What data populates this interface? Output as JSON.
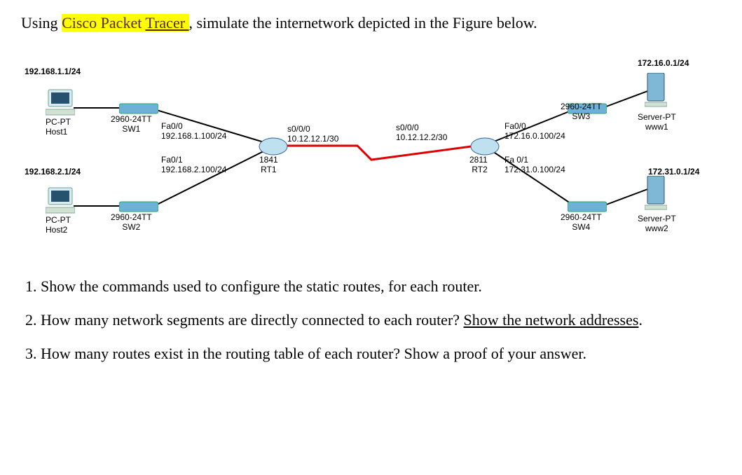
{
  "intro": {
    "prefix": "Using ",
    "highlight_cisco": "Cisco Packet ",
    "highlight_tracer": "Tracer ",
    "comma": ", ",
    "rest": "simulate the internetwork depicted in the Figure below."
  },
  "diagram": {
    "top_left_net": "192.168.1.1/24",
    "top_right_net": "172.16.0.1/24",
    "mid_left_net": "192.168.2.1/24",
    "mid_right_net": "172.31.0.1/24",
    "host1": {
      "l1": "PC-PT",
      "l2": "Host1"
    },
    "host2": {
      "l1": "PC-PT",
      "l2": "Host2"
    },
    "sw1": {
      "l1": "2960-24TT",
      "l2": "SW1"
    },
    "sw2": {
      "l1": "2960-24TT",
      "l2": "SW2"
    },
    "sw3": {
      "l1": "2960-24TT",
      "l2": "SW3"
    },
    "sw4": {
      "l1": "2960-24TT",
      "l2": "SW4"
    },
    "rt1": {
      "model": "1841",
      "name": "RT1"
    },
    "rt2": {
      "model": "2811",
      "name": "RT2"
    },
    "fa00_l": {
      "l1": "Fa0/0",
      "l2": "192.168.1.100/24"
    },
    "fa01_l": {
      "l1": "Fa0/1",
      "l2": "192.168.2.100/24"
    },
    "s000_l": {
      "l1": "s0/0/0",
      "l2": "10.12.12.1/30"
    },
    "s000_r": {
      "l1": "s0/0/0",
      "l2": "10.12.12.2/30"
    },
    "fa00_r": {
      "l1": "Fa0/0",
      "l2": "172.16.0.100/24"
    },
    "fa01_r": {
      "l1": "Fa 0/1",
      "l2": "172.31.0.100/24"
    },
    "www1": {
      "l1": "Server-PT",
      "l2": "www1"
    },
    "www2": {
      "l1": "Server-PT",
      "l2": "www2"
    }
  },
  "questions": {
    "q1": "Show the commands used to configure the static routes, for each router.",
    "q2a": "How many network segments are directly connected to each router?  ",
    "q2b": "Show the network addresses",
    "q2c": ".",
    "q3": "How many routes exist in the routing table of each router? Show a proof of your answer."
  }
}
